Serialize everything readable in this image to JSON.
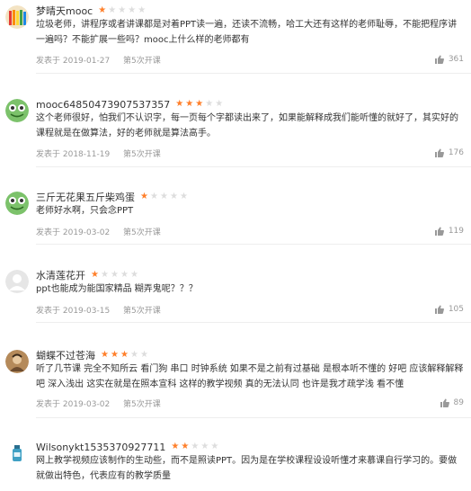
{
  "reviews": [
    {
      "user": "梦晴天mooc",
      "avatar_icon": "pencils-avatar-icon",
      "rating": 1,
      "text": "垃圾老师，讲程序或者讲课都是对着PPT读一遍，还读不流畅，哈工大还有这样的老师耻辱，不能把程序讲一遍吗？不能扩展一些吗？mooc上什么样的老师都有",
      "date": "发表于 2019-01-27",
      "term": "第5次开课",
      "likes": "361"
    },
    {
      "user": "mooc64850473907537357",
      "avatar_icon": "green-frog-avatar-icon",
      "rating": 3,
      "text": "这个老师很好，怕我们不认识字，每一页每个字都读出来了，如果能解释成我们能听懂的就好了，其实好的课程就是在做算法，好的老师就是算法高手。",
      "date": "发表于 2018-11-19",
      "term": "第5次开课",
      "likes": "176"
    },
    {
      "user": "三斤无花果五斤柴鸡蛋",
      "avatar_icon": "green-frog-avatar-icon",
      "rating": 1,
      "text": "老师好水啊，只会念PPT",
      "date": "发表于 2019-03-02",
      "term": "第5次开课",
      "likes": "119"
    },
    {
      "user": "水清莲花开",
      "avatar_icon": "default-user-avatar-icon",
      "rating": 1,
      "text": "ppt也能成为能国家精品 糊弄鬼呢？？？",
      "date": "发表于 2019-03-15",
      "term": "第5次开课",
      "likes": "105"
    },
    {
      "user": "蝴蝶不过苍海",
      "avatar_icon": "photo-avatar-icon",
      "rating": 3,
      "text": "听了几节课 完全不知所云 看门狗 串口 时钟系统 如果不是之前有过基础 是根本听不懂的 好吧 应该解释解释吧 深入浅出 这实在就是在照本宣科 这样的教学视频 真的无法认同 也许是我才疏学浅 看不懂",
      "date": "发表于 2019-03-02",
      "term": "第5次开课",
      "likes": "89"
    },
    {
      "user": "Wilsonykt1535370927711",
      "avatar_icon": "bottle-avatar-icon",
      "rating": 2,
      "text": "网上教学视频应该制作的生动些，而不是照读PPT。因为是在学校课程设设听懂才来慕课自行学习的。要做就做出特色，代表应有的教学质量",
      "date": "",
      "term": "",
      "likes": ""
    }
  ],
  "colors": {
    "star_on": "#ff7f2a",
    "star_off": "#dddddd",
    "meta": "#999999",
    "text": "#333333"
  }
}
